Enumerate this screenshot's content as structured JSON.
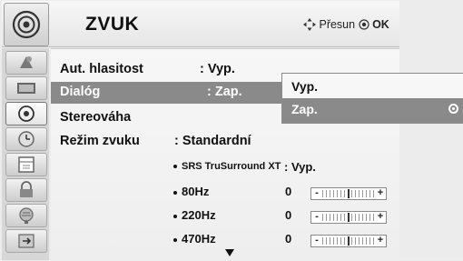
{
  "header": {
    "title": "ZVUK",
    "hint_move": "Přesun",
    "hint_ok": "OK",
    "icon": "speaker-icon"
  },
  "sidebar": {
    "icons": [
      "picture-icon",
      "screen-icon",
      "speaker-icon",
      "clock-icon",
      "calendar-icon",
      "lock-icon",
      "globe-icon",
      "input-icon"
    ],
    "active_index": 2
  },
  "menu": {
    "items": [
      {
        "label": "Aut. hlasitost",
        "value": ": Vyp."
      },
      {
        "label": "Dialóg",
        "value": ": Zap."
      },
      {
        "label": "Stereováha",
        "value": ""
      },
      {
        "label": "Režim zvuku",
        "value": ": Standardní"
      }
    ],
    "sub": {
      "srs_label": "SRS TruSurround XT",
      "srs_value": ": Vyp.",
      "eq": [
        {
          "label": "80Hz",
          "value": "0",
          "level": 0.5
        },
        {
          "label": "220Hz",
          "value": "0",
          "level": 0.5
        },
        {
          "label": "470Hz",
          "value": "0",
          "level": 0.5
        }
      ]
    }
  },
  "dropdown": {
    "options": [
      "Vyp.",
      "Zap."
    ],
    "selected": "Zap."
  }
}
